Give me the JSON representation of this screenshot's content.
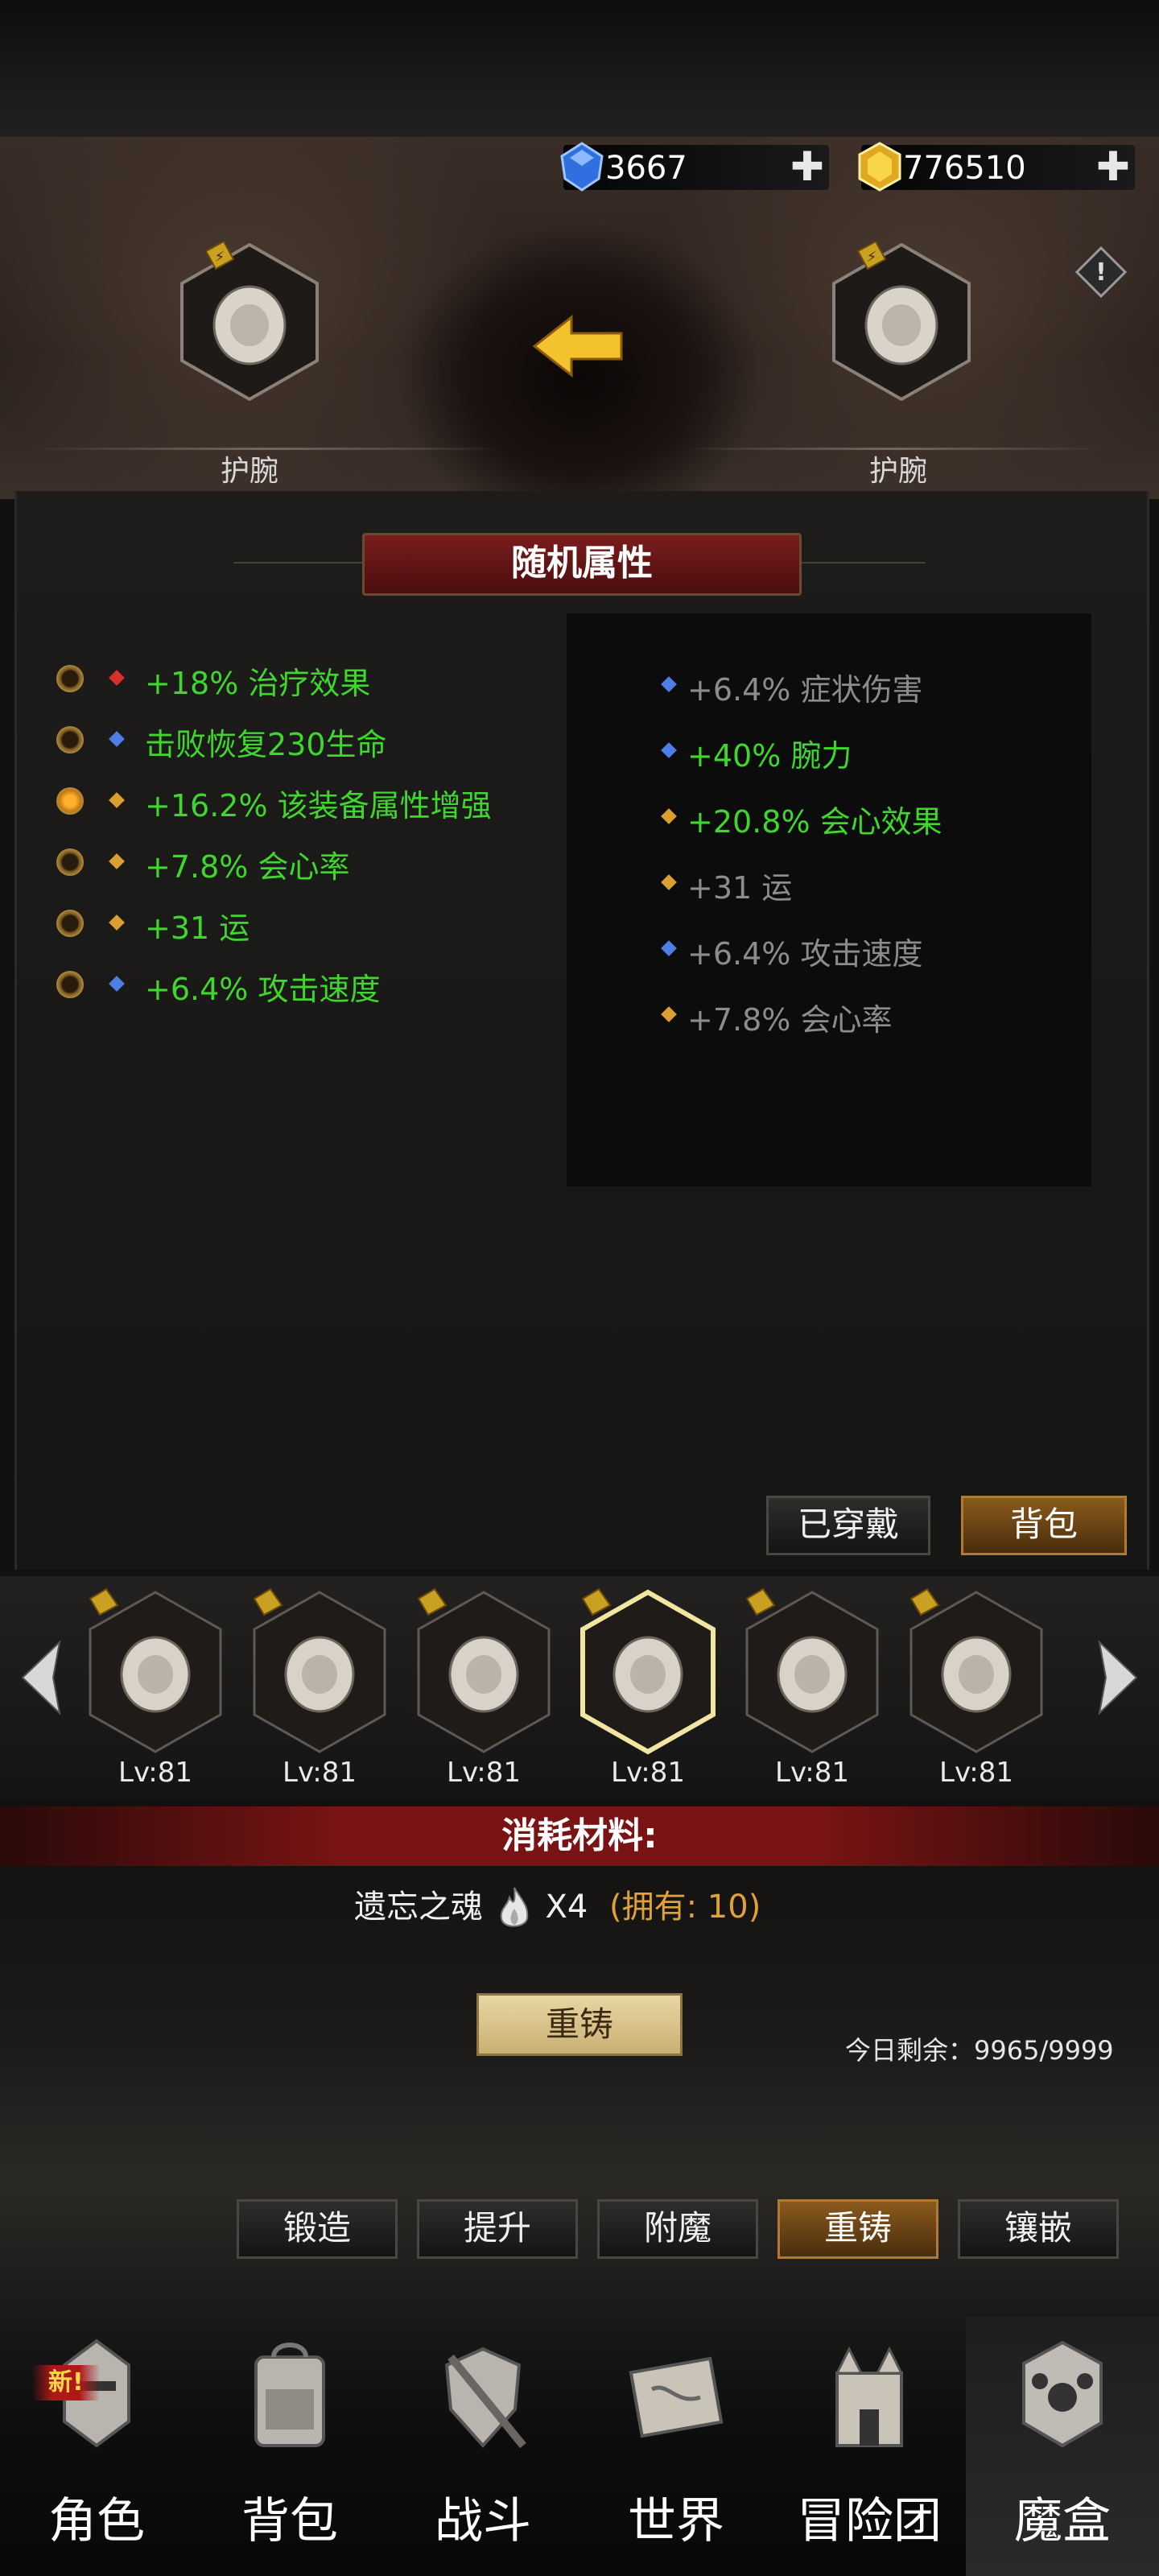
{
  "currency": {
    "gems": "3667",
    "gold": "776510"
  },
  "header": {
    "left_item_label": "护腕",
    "right_item_label": "护腕"
  },
  "section_title": "随机属性",
  "current_attrs": [
    {
      "text": "+18% 治疗效果",
      "gem": "red",
      "active": false
    },
    {
      "text": "击败恢复230生命",
      "gem": "blue",
      "active": false
    },
    {
      "text": "+16.2% 该装备属性增强",
      "gem": "gold",
      "active": true
    },
    {
      "text": "+7.8% 会心率",
      "gem": "gold",
      "active": false
    },
    {
      "text": "+31 运",
      "gem": "gold",
      "active": false
    },
    {
      "text": "+6.4% 攻击速度",
      "gem": "blue",
      "active": false
    }
  ],
  "new_attrs": [
    {
      "text": "+6.4% 症状伤害",
      "gem": "blue",
      "highlight": false
    },
    {
      "text": "+40% 腕力",
      "gem": "blue",
      "highlight": true
    },
    {
      "text": "+20.8% 会心效果",
      "gem": "gold",
      "highlight": true
    },
    {
      "text": "+31 运",
      "gem": "gold",
      "highlight": false
    },
    {
      "text": "+6.4% 攻击速度",
      "gem": "blue",
      "highlight": false
    },
    {
      "text": "+7.8% 会心率",
      "gem": "gold",
      "highlight": false
    }
  ],
  "filter_buttons": {
    "equipped": "已穿戴",
    "backpack": "背包"
  },
  "carousel": [
    {
      "level": "Lv:81",
      "selected": false
    },
    {
      "level": "Lv:81",
      "selected": false
    },
    {
      "level": "Lv:81",
      "selected": false
    },
    {
      "level": "Lv:81",
      "selected": true
    },
    {
      "level": "Lv:81",
      "selected": false
    },
    {
      "level": "Lv:81",
      "selected": false
    }
  ],
  "consume": {
    "title": "消耗材料:",
    "material_name": "遗忘之魂",
    "material_qty": "X4",
    "owned": "(拥有: 10)"
  },
  "recast_button": "重铸",
  "daily_remaining": "今日剩余：9965/9999",
  "tabs": [
    "锻造",
    "提升",
    "附魔",
    "重铸",
    "镶嵌"
  ],
  "active_tab": 3,
  "nav": [
    {
      "label": "角色",
      "badge": "新!",
      "icon": "knight-helmet-icon"
    },
    {
      "label": "背包",
      "icon": "backpack-icon"
    },
    {
      "label": "战斗",
      "icon": "shield-sword-icon"
    },
    {
      "label": "世界",
      "icon": "map-scroll-icon"
    },
    {
      "label": "冒险团",
      "icon": "castle-icon"
    },
    {
      "label": "魔盒",
      "icon": "magic-box-icon"
    }
  ],
  "active_nav": 5,
  "colors": {
    "attr_green": "#3fd62d",
    "attr_grey": "#8c8c8c",
    "banner_red": "#7a1c1c",
    "tab_active": "#8a5a1e"
  }
}
